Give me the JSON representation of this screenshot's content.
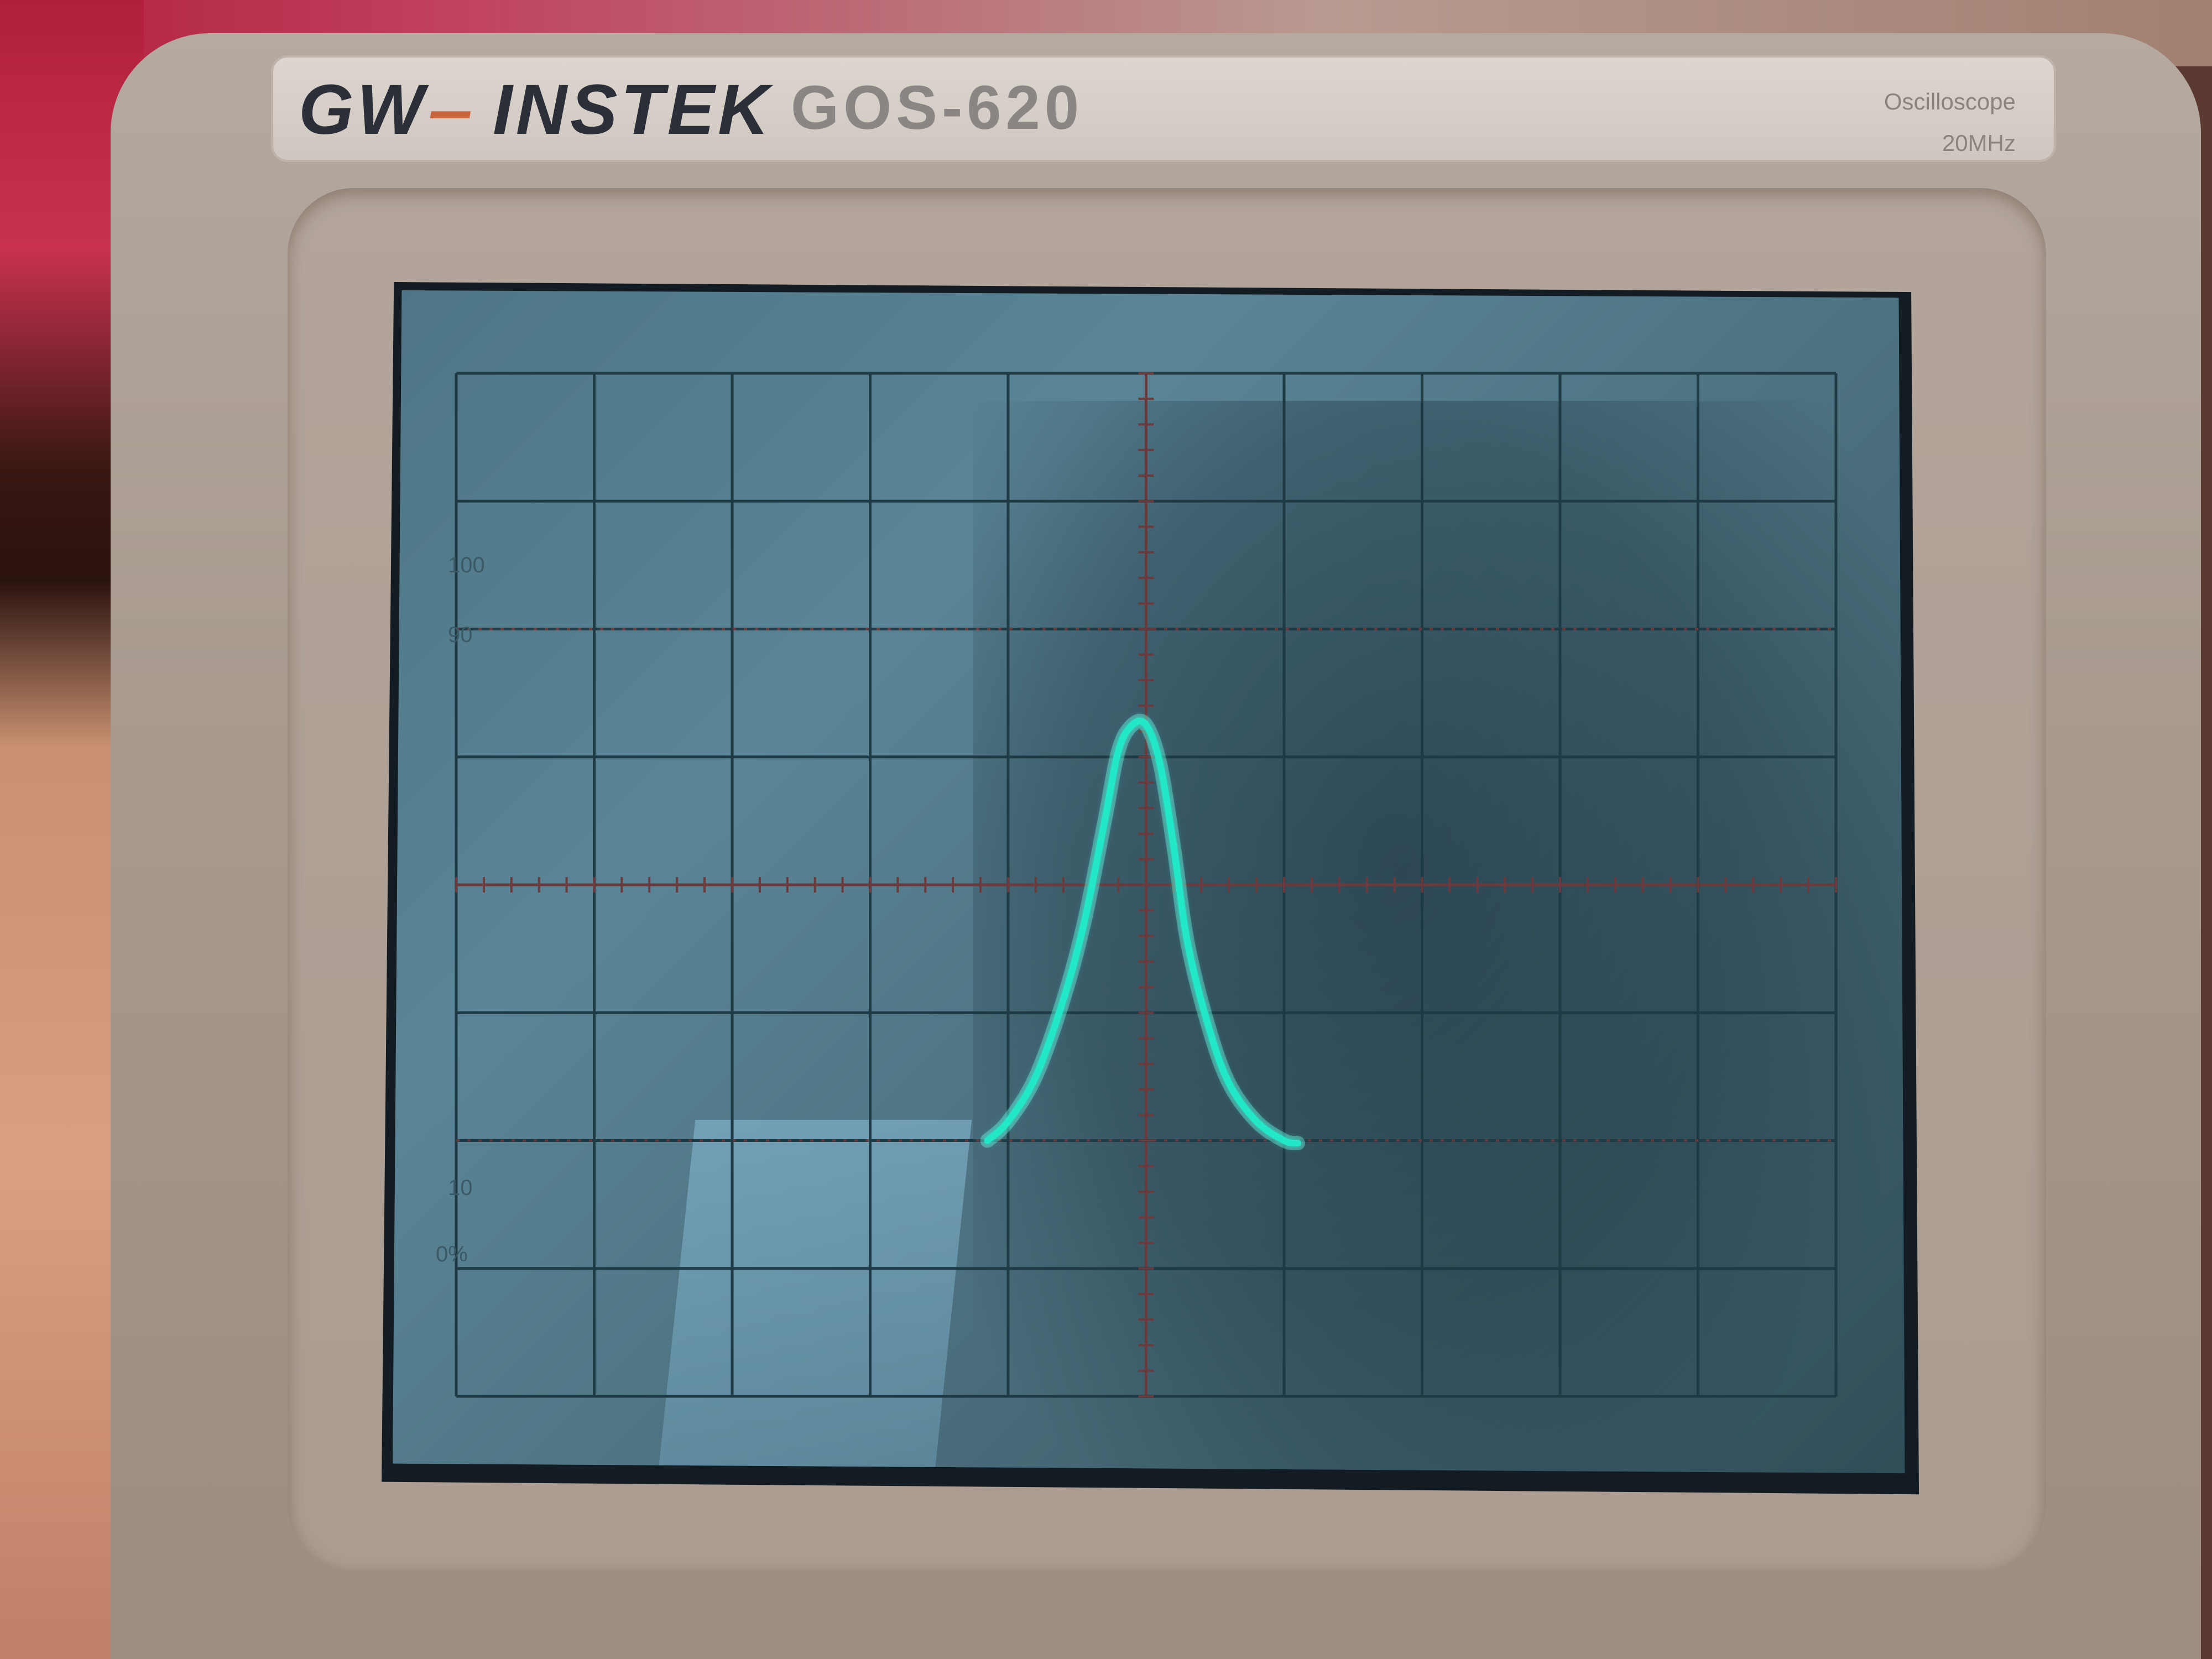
{
  "device": {
    "brand": "GW INSTEK",
    "brand_mark": "GW",
    "brand_word": "INSTEK",
    "model": "GOS-620",
    "type": "Oscilloscope",
    "bandwidth": "20MHz"
  },
  "graticule": {
    "label_100": "100",
    "label_90": "90",
    "label_10": "10",
    "label_0": "0%"
  },
  "colors": {
    "trace": "#22e8c8",
    "trace_glow": "#8ffff0",
    "grid": "#1e3a44",
    "center_axis": "#6a3a3c"
  },
  "chart_data": {
    "type": "line",
    "title": "",
    "xlabel": "",
    "ylabel": "",
    "grid": true,
    "xlim": [
      -5,
      5
    ],
    "ylim": [
      -4,
      4
    ],
    "series": [
      {
        "values_x": [
          -1.15,
          -1.0,
          -0.8,
          -0.6,
          -0.45,
          -0.3,
          -0.2,
          -0.1,
          0.0,
          0.1,
          0.2,
          0.3,
          0.45,
          0.6,
          0.8,
          1.0,
          1.1
        ],
        "values_y": [
          -2.0,
          -1.85,
          -1.5,
          -0.9,
          -0.3,
          0.5,
          1.05,
          1.25,
          1.25,
          0.95,
          0.3,
          -0.45,
          -1.1,
          -1.55,
          -1.85,
          -2.0,
          -2.02
        ]
      }
    ]
  }
}
